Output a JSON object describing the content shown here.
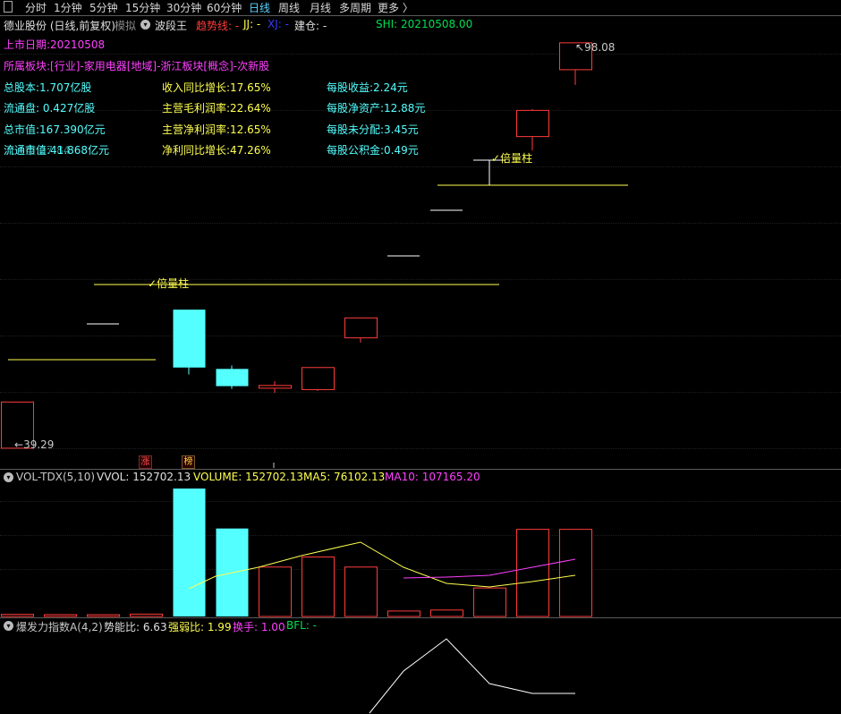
{
  "toolbar": {
    "items": [
      "分时",
      "1分钟",
      "5分钟",
      "15分钟",
      "30分钟",
      "60分钟",
      "日线",
      "周线",
      "月线",
      "多周期",
      "更多 〉"
    ],
    "active": "日线"
  },
  "main_header": {
    "stock": "德业股份 (日线,前复权)",
    "mode": "模拟",
    "indicator": "波段王",
    "trend": "趋势线: -",
    "jj": "JJ: -",
    "xj": "XJ: -",
    "build": "建仓: -",
    "shi": "SHI: 20210508.00"
  },
  "info": {
    "listing": "上市日期:20210508",
    "sector": "所属板块:[行业]-家用电器[地域]-浙江板块[概念]-次新股",
    "col1": [
      "总股本:1.707亿股",
      "流通盘: 0.427亿股",
      "总市值:167.390亿元",
      "流通市值:41.868亿元"
    ],
    "col1_overlap": "流通盘:27.84",
    "col2": [
      "收入同比增长:17.65%",
      "主营毛利润率:22.64%",
      "主营净利润率:12.65%",
      "净利同比增长:47.26%"
    ],
    "col3": [
      "每股收益:2.24元",
      "每股净资产:12.88元",
      "每股未分配:3.45元",
      "每股公积金:0.49元"
    ]
  },
  "annotations": {
    "high_price": "98.08",
    "low_price": "39.29",
    "bei_liang_1": "倍量柱",
    "bei_liang_2": "倍量柱",
    "tag_zhang": "涨",
    "tag_bang": "榜"
  },
  "vol_header": {
    "name": "VOL-TDX(5,10)",
    "vvol": "VVOL: 152702.13",
    "volume": "VOLUME: 152702.13",
    "ma5": "MA5: 76102.13",
    "ma10": "MA10: 107165.20"
  },
  "burst_header": {
    "name": "爆发力指数A(4,2)",
    "power": "势能比: 6.63",
    "strength": "强弱比: 1.99",
    "turnover": "换手: 1.00",
    "bfl": "BFL: -"
  },
  "colors": {
    "up": "#ff3c3c",
    "down": "#54ffff",
    "ma5": "#ffff50",
    "ma10": "#ff40ff",
    "burst": "#ffffff",
    "shi": "#00e050",
    "magenta": "#ff40ff",
    "yellow": "#ffff50",
    "cyan": "#54ffff"
  },
  "chart_data": {
    "type": "candlestick",
    "price_range": [
      39.29,
      98.08
    ],
    "candles": [
      {
        "o": 39.3,
        "c": 46.0,
        "h": 46.0,
        "l": 39.3,
        "dir": "up"
      },
      {
        "o": 56.6,
        "c": 56.6,
        "h": 56.6,
        "l": 56.6,
        "dir": "flat"
      },
      {
        "o": 59.4,
        "c": 51.0,
        "h": 59.4,
        "l": 50.0,
        "dir": "down"
      },
      {
        "o": 48.3,
        "c": 50.8,
        "h": 51.3,
        "l": 47.9,
        "dir": "down"
      },
      {
        "o": 48.0,
        "c": 48.4,
        "h": 49.0,
        "l": 47.3,
        "dir": "up"
      },
      {
        "o": 47.8,
        "c": 51.0,
        "h": 51.0,
        "l": 47.6,
        "dir": "up"
      },
      {
        "o": 55.3,
        "c": 58.2,
        "h": 58.2,
        "l": 54.6,
        "dir": "up"
      },
      {
        "o": 64.3,
        "c": 64.3,
        "h": 64.3,
        "l": 64.3,
        "dir": "flat"
      },
      {
        "o": 70.3,
        "c": 70.3,
        "h": 70.3,
        "l": 70.3,
        "dir": "flat"
      },
      {
        "o": 76.3,
        "c": 76.3,
        "h": 76.3,
        "l": 76.3,
        "dir": "flat"
      },
      {
        "o": 84.5,
        "c": 88.3,
        "h": 88.5,
        "l": 82.5,
        "dir": "up"
      },
      {
        "o": 94.2,
        "c": 98.1,
        "h": 98.1,
        "l": 92.0,
        "dir": "up"
      }
    ],
    "volume": [
      2500,
      2200,
      2000,
      2800,
      152702,
      105000,
      59000,
      71000,
      59000,
      6500,
      7700,
      34000,
      104000,
      104000
    ],
    "volume_dir": [
      "up",
      "up",
      "up",
      "up",
      "down",
      "down",
      "up",
      "up",
      "up",
      "up",
      "up",
      "up",
      "up",
      "up"
    ],
    "vol_ma5": [
      null,
      null,
      null,
      null,
      null,
      null,
      null,
      null,
      null,
      null,
      null,
      null,
      null,
      null
    ],
    "burst": [
      null,
      null,
      null,
      null,
      null,
      null,
      null,
      null,
      null,
      2.2,
      4.0,
      5.8,
      3.6,
      3.0,
      3.0
    ]
  }
}
